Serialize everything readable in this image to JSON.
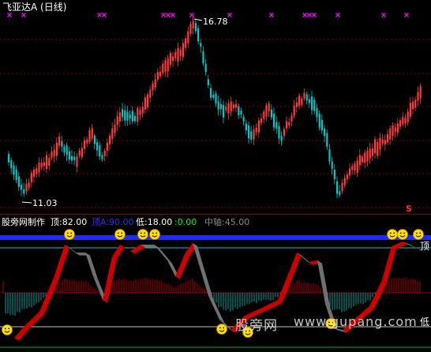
{
  "price_panel": {
    "title": "飞亚达A (日线)",
    "high_label": "16.78",
    "low_label": "11.03",
    "s_marker": "S",
    "top_markers_symbol": "×",
    "colors": {
      "up": "#ff3b3b",
      "down": "#00c8c8",
      "marker": "#ff00ff",
      "grid": "#8b0000",
      "text": "#ffffff"
    }
  },
  "indicator_panel": {
    "author_label": "股旁网制作",
    "legend": [
      {
        "key": "top",
        "text": "顶:82.00",
        "color": "#ffffff"
      },
      {
        "key": "topA",
        "text": "顶A:90.00",
        "color": "#3030ff"
      },
      {
        "key": "low",
        "text": "低:18.00",
        "color": "#ffffff"
      },
      {
        "key": "zero",
        "text": ":0.00",
        "color": "#00ff00"
      },
      {
        "key": "axis",
        "text": "中轴:45.00",
        "color": "#888888"
      }
    ],
    "right_top_label": "顶",
    "right_low_label": "低",
    "smiley_icon": "smiley-face-icon",
    "colors": {
      "band_up": "#cc0000",
      "band_down": "#707070",
      "topA_line": "#1e2bff",
      "top_line": "#00c8c8",
      "hist_pos": "#b00000",
      "hist_neg": "#00a0a0"
    }
  },
  "watermark": {
    "cn": "股旁网",
    "url": "www.gupang.com"
  }
}
